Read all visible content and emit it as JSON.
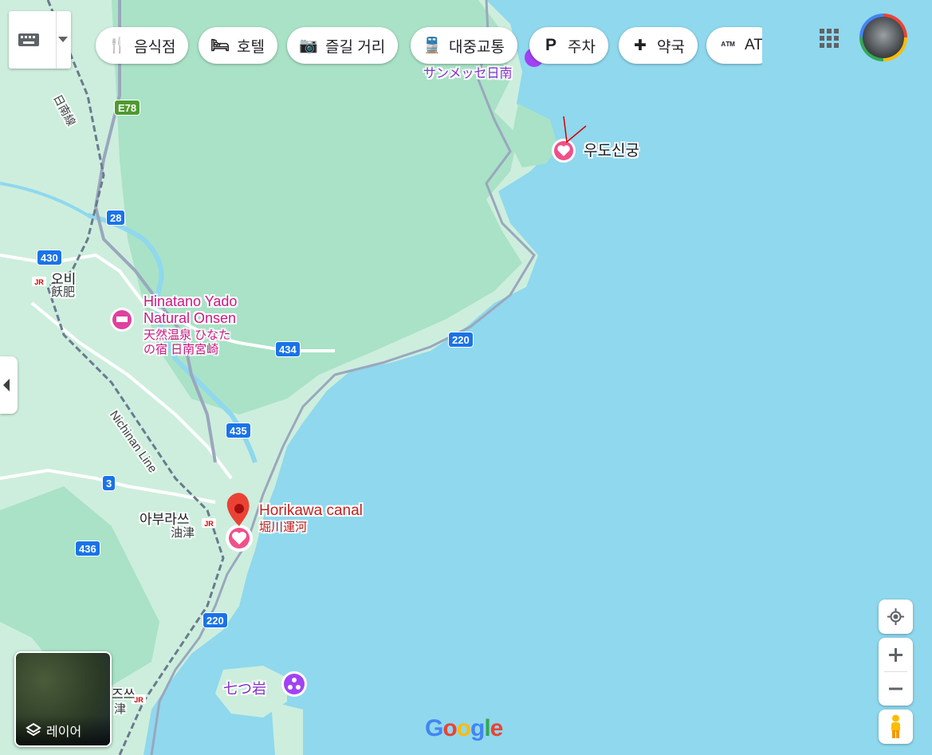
{
  "chips": [
    {
      "icon": "utensils-icon",
      "glyph": "🍴",
      "label": "음식점"
    },
    {
      "icon": "bed-icon",
      "glyph": "🛏",
      "label": "호텔"
    },
    {
      "icon": "camera-icon",
      "glyph": "📷",
      "label": "즐길 거리"
    },
    {
      "icon": "train-icon",
      "glyph": "🚆",
      "label": "대중교통"
    },
    {
      "icon": "parking-icon",
      "glyph": "P",
      "label": "주차"
    },
    {
      "icon": "pharmacy-icon",
      "glyph": "✚",
      "label": "약국"
    },
    {
      "icon": "atm-icon",
      "glyph": "ᴬᵀᴹ",
      "label": "AT"
    }
  ],
  "places": {
    "udo": {
      "label": "우도신궁"
    },
    "horikawa": {
      "label": "Horikawa canal",
      "sub": "堀川運河"
    },
    "hinatano": {
      "line1": "Hinatano Yado",
      "line2": "Natural Onsen",
      "line3": "天然温泉 ひなた",
      "line4": "の宿 日南宮崎"
    },
    "nanatsuiwa": {
      "label": "七つ岩"
    },
    "sunmesse": {
      "label": "サンメッセ日南"
    }
  },
  "towns": {
    "obi": {
      "ko": "오비",
      "ja": "飫肥"
    },
    "aburatsu": {
      "ko": "아부라쓰",
      "ja": "油津"
    },
    "otsu_partial": {
      "ko": "즈쓰",
      "ja": "津"
    }
  },
  "rail": {
    "nichinan_line": "Nichinan Line",
    "nichinan_sen": "日南線",
    "jr": "JR"
  },
  "roads": [
    "E78",
    "28",
    "430",
    "434",
    "220",
    "435",
    "3",
    "436",
    "220"
  ],
  "layer_label": "레이어",
  "logo": "Google",
  "colors": {
    "water": "#8fd8ee",
    "land": "#cfeee0",
    "forest": "#a8e0c4",
    "poi_red": "#ea4335",
    "poi_pink": "#f0508a",
    "poi_purple": "#a142f4",
    "road_blue": "#1a73e8"
  }
}
